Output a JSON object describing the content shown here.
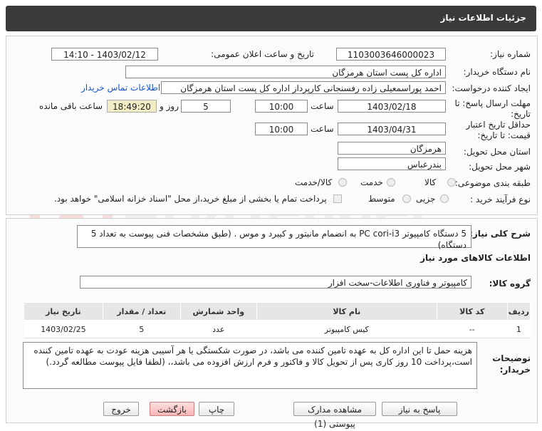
{
  "header": {
    "title": "جزئیات اطلاعات نیاز"
  },
  "fields": {
    "need_number_label": "شماره نیاز:",
    "need_number": "1103003646000023",
    "announce_label": "تاریخ و ساعت اعلان عمومی:",
    "announce_value": "1403/02/12 - 14:10",
    "buyer_org_label": "نام دستگاه خریدار:",
    "buyer_org": "اداره کل پست استان هرمزگان",
    "creator_label": "ایجاد کننده درخواست:",
    "creator": "احمد پوراسمعیلی زاده رفسنجانی کارپرداز اداره کل پست استان هرمزگان",
    "contact_link": "اطلاعات تماس خریدار",
    "deadline_label_1": "مهلت ارسال پاسخ: تا",
    "deadline_label_2": "تاریخ:",
    "deadline_date": "1403/02/18",
    "time_label": "ساعت",
    "deadline_time": "10:00",
    "days_value": "5",
    "days_label": "روز و",
    "remaining_time": "18:49:20",
    "remaining_label": "ساعت باقی مانده",
    "validity_label_1": "حداقل تاریخ اعتبار",
    "validity_label_2": "قیمت: تا تاریخ:",
    "validity_date": "1403/04/31",
    "validity_time": "10:00",
    "province_label": "استان محل تحویل:",
    "province": "هرمزگان",
    "city_label": "شهر محل تحویل:",
    "city": "بندرعباس",
    "category_label": "طبقه بندی موضوعی:",
    "category_options": [
      "کالا",
      "خدمت",
      "کالا/خدمت"
    ],
    "process_label": "نوع فرآیند خرید :",
    "process_options": [
      "جزیی",
      "متوسط"
    ],
    "payment_note": "پرداخت تمام یا بخشی از مبلغ خرید،از محل \"اسناد خزانه اسلامی\" خواهد بود."
  },
  "summary": {
    "label": "شرح کلی نیاز:",
    "text": "5 دستگاه کامپیوتر PC cori-i3 به انضمام مانیتور و کیبرد و موس . (طبق مشخصات فنی پیوست به تعداد 5 دستگاه)"
  },
  "goods_section_title": "اطلاعات کالاهای مورد نیاز",
  "goods_group": {
    "label": "گروه کالا:",
    "value": "کامپیوتر و فناوری اطلاعات-سخت افزار"
  },
  "table": {
    "headers": [
      "ردیف",
      "کد کالا",
      "نام کالا",
      "واحد شمارش",
      "تعداد / مقدار",
      "تاریخ نیاز"
    ],
    "rows": [
      [
        "1",
        "--",
        "کیس کامپیوتر",
        "عدد",
        "5",
        "1403/02/25"
      ]
    ]
  },
  "buyer_notes": {
    "label_1": "توضیحات",
    "label_2": "خریدار:",
    "text": "هزینه حمل تا این اداره کل به عهده تامین کننده می باشد، در صورت شکستگی یا هر آسیبی هزینه عودت به عهده تامین کننده است،پرداخت 10 روز کاری پس از تحویل کالا و فاکتور و فرم ارزش افزوده می باشد،، (لطفا فایل پیوست مطالعه گردد.)"
  },
  "buttons": {
    "reply": "پاسخ به نیاز",
    "view_docs": "مشاهده مدارک پیوستی (1)",
    "print": "چاپ",
    "back": "بازگشت",
    "exit": "خروج"
  },
  "watermark": "AriaTender.neT",
  "colors": {
    "title_bg": "#3a3a3a",
    "time_highlight": "#f2edc4",
    "link": "#1a56c9",
    "danger_button": "#f5b5b5"
  }
}
